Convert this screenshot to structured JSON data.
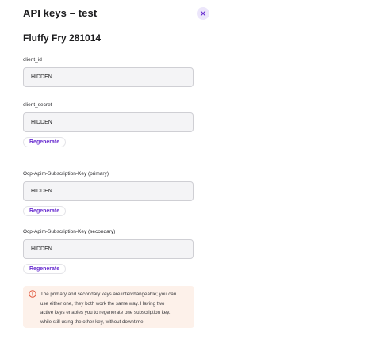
{
  "header": {
    "title": "API keys – test",
    "close_icon": "close-icon"
  },
  "app": {
    "name": "Fluffy Fry 281014"
  },
  "fields": {
    "client_id": {
      "label": "client_id",
      "value": "HIDDEN"
    },
    "client_secret": {
      "label": "client_secret",
      "value": "HIDDEN",
      "action": "Regenerate"
    },
    "primary_key": {
      "label": "Ocp-Apim-Subscription-Key (primary)",
      "value": "HIDDEN",
      "action": "Regenerate"
    },
    "secondary_key": {
      "label": "Ocp-Apim-Subscription-Key (secondary)",
      "value": "HIDDEN",
      "action": "Regenerate"
    }
  },
  "info": {
    "icon": "alert-circle-icon",
    "lines": [
      "The primary and secondary keys are interchangeable; you can",
      "use either one, they both work the same way. Having two",
      "active keys enables you to regenerate one subscription key,",
      "while still using the other key, without downtime."
    ]
  },
  "colors": {
    "accent": "#6a2fd0",
    "close_bg": "#ece6fb",
    "info_bg": "#fdf1ea",
    "info_icon": "#e0553a",
    "field_bg": "#f4f4f6",
    "field_border": "#cfcfd4"
  }
}
